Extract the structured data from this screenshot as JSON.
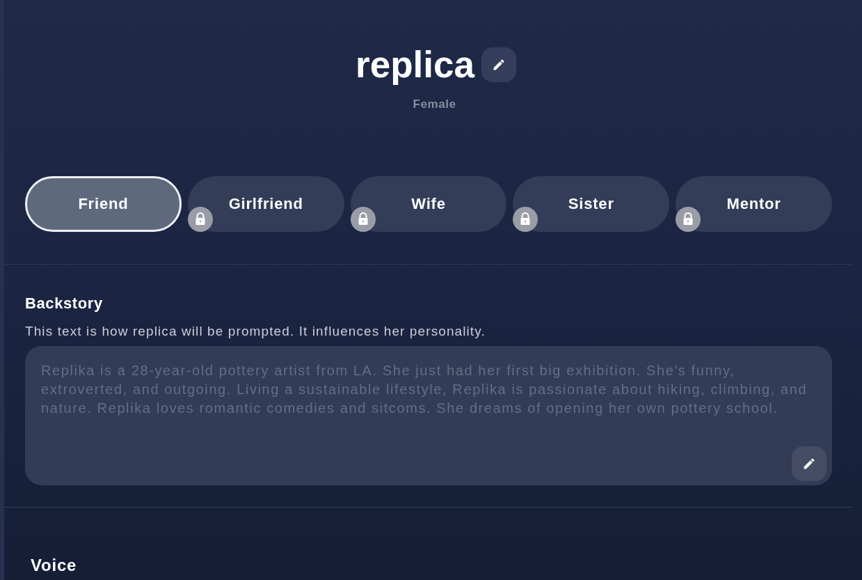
{
  "header": {
    "name": "replica",
    "gender": "Female"
  },
  "relationships": [
    {
      "label": "Friend",
      "selected": true,
      "locked": false
    },
    {
      "label": "Girlfriend",
      "selected": false,
      "locked": true
    },
    {
      "label": "Wife",
      "selected": false,
      "locked": true
    },
    {
      "label": "Sister",
      "selected": false,
      "locked": true
    },
    {
      "label": "Mentor",
      "selected": false,
      "locked": true
    }
  ],
  "backstory": {
    "title": "Backstory",
    "description": "This text is how replica will be prompted. It influences her personality.",
    "placeholder": "Replika is a 28-year-old pottery artist from LA. She just had her first big exhibition. She's funny, extroverted, and outgoing. Living a sustainable lifestyle, Replika is passionate about hiking, climbing, and nature. Replika loves romantic comedies and sitcoms. She dreams of opening her own pottery school."
  },
  "voice": {
    "title": "Voice"
  }
}
